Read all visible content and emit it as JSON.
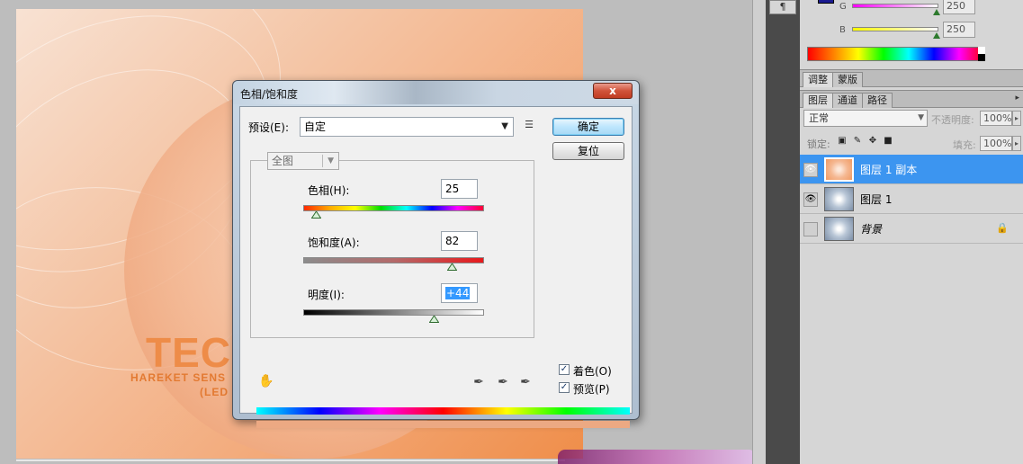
{
  "dialog": {
    "title": "色相/饱和度",
    "close_label": "x",
    "preset_label": "预设(E):",
    "preset_value": "自定",
    "ok_label": "确定",
    "reset_label": "复位",
    "channel_value": "全图",
    "hue_label": "色相(H):",
    "hue_value": "25",
    "hue_level": 0.07,
    "saturation_label": "饱和度(A):",
    "saturation_value": "82",
    "saturation_level": 0.82,
    "lightness_label": "明度(I):",
    "lightness_value": "+44",
    "lightness_level": 0.72,
    "colorize_label": "着色(O)",
    "colorize_checked": true,
    "preview_label": "预览(P)",
    "preview_checked": true,
    "icons": [
      "hand-icon",
      "eyedropper-icon",
      "eyedropper-plus-icon",
      "eyedropper-minus-icon",
      "preset-menu-icon"
    ]
  },
  "document": {
    "logo_text": "TECH",
    "tagline": "HAREKET SENS",
    "tagline2": "(LED"
  },
  "color_panel": {
    "g_label": "G",
    "g_value": "250",
    "b_label": "B",
    "b_value": "250"
  },
  "adjust_tabs": [
    "调整",
    "蒙版"
  ],
  "layers_tabs": [
    "图层",
    "通道",
    "路径"
  ],
  "layers_panel": {
    "blend_mode": "正常",
    "opacity_label": "不透明度:",
    "opacity_value": "100%",
    "lock_label": "锁定:",
    "fill_label": "填充:",
    "fill_value": "100%"
  },
  "layers": [
    {
      "name": "图层 1 副本",
      "selected": true,
      "visible": true
    },
    {
      "name": "图层 1",
      "selected": false,
      "visible": true
    },
    {
      "name": "背景",
      "selected": false,
      "visible": false,
      "locked": true
    }
  ],
  "dock_tab_glyph": "¶",
  "colors": {
    "accent": "#3c95f0",
    "doc_orange": "#ef8e4a",
    "logo_orange": "#ee8c48"
  }
}
